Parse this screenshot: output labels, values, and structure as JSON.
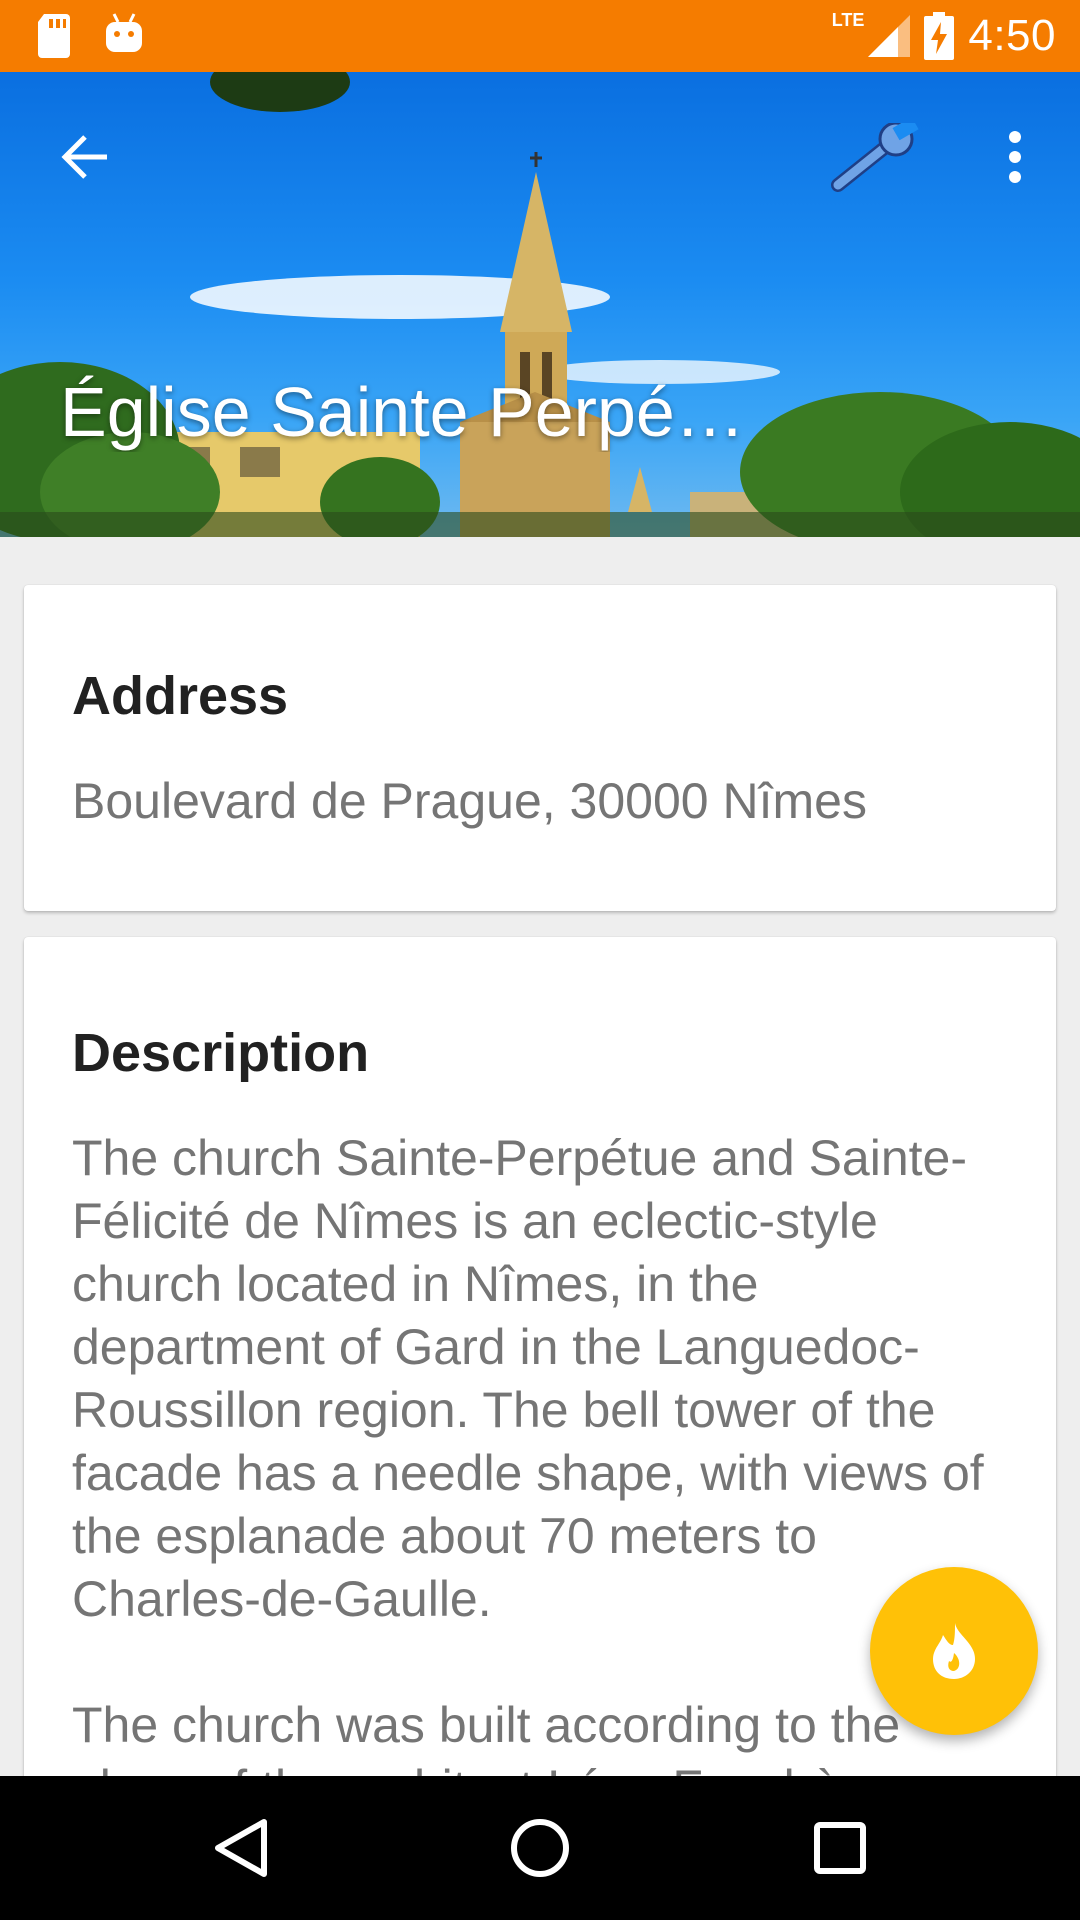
{
  "status_bar": {
    "time": "4:50",
    "network": "LTE",
    "icons": [
      "sd-card-icon",
      "android-icon",
      "lte-signal-icon",
      "battery-charging-icon"
    ]
  },
  "header": {
    "title": "Église Sainte Perpétue et Sainte Félicité",
    "icons": [
      "back-arrow-icon",
      "wrench-icon",
      "more-vert-icon"
    ]
  },
  "address_card": {
    "title": "Address",
    "text": "Boulevard de Prague, 30000 Nîmes"
  },
  "description_card": {
    "title": "Description",
    "paragraph1": "The church Sainte-Perpétue and Sainte-Félicité de Nîmes is an eclectic-style church located in Nîmes, in the department of Gard in the Languedoc-Roussillon region. The bell tower of the facade has a needle shape, with views of the esplanade about 70 meters to Charles-de-Gaulle.",
    "paragraph2": "The church was built according to the plans of the architect Léon Feuchère"
  },
  "fab": {
    "icon": "flame-icon"
  },
  "nav_bar": {
    "icons": [
      "nav-back-icon",
      "nav-home-icon",
      "nav-recent-icon"
    ]
  },
  "colors": {
    "status_bar": "#f57c00",
    "fab": "#ffc107",
    "background": "#eeeeee"
  }
}
